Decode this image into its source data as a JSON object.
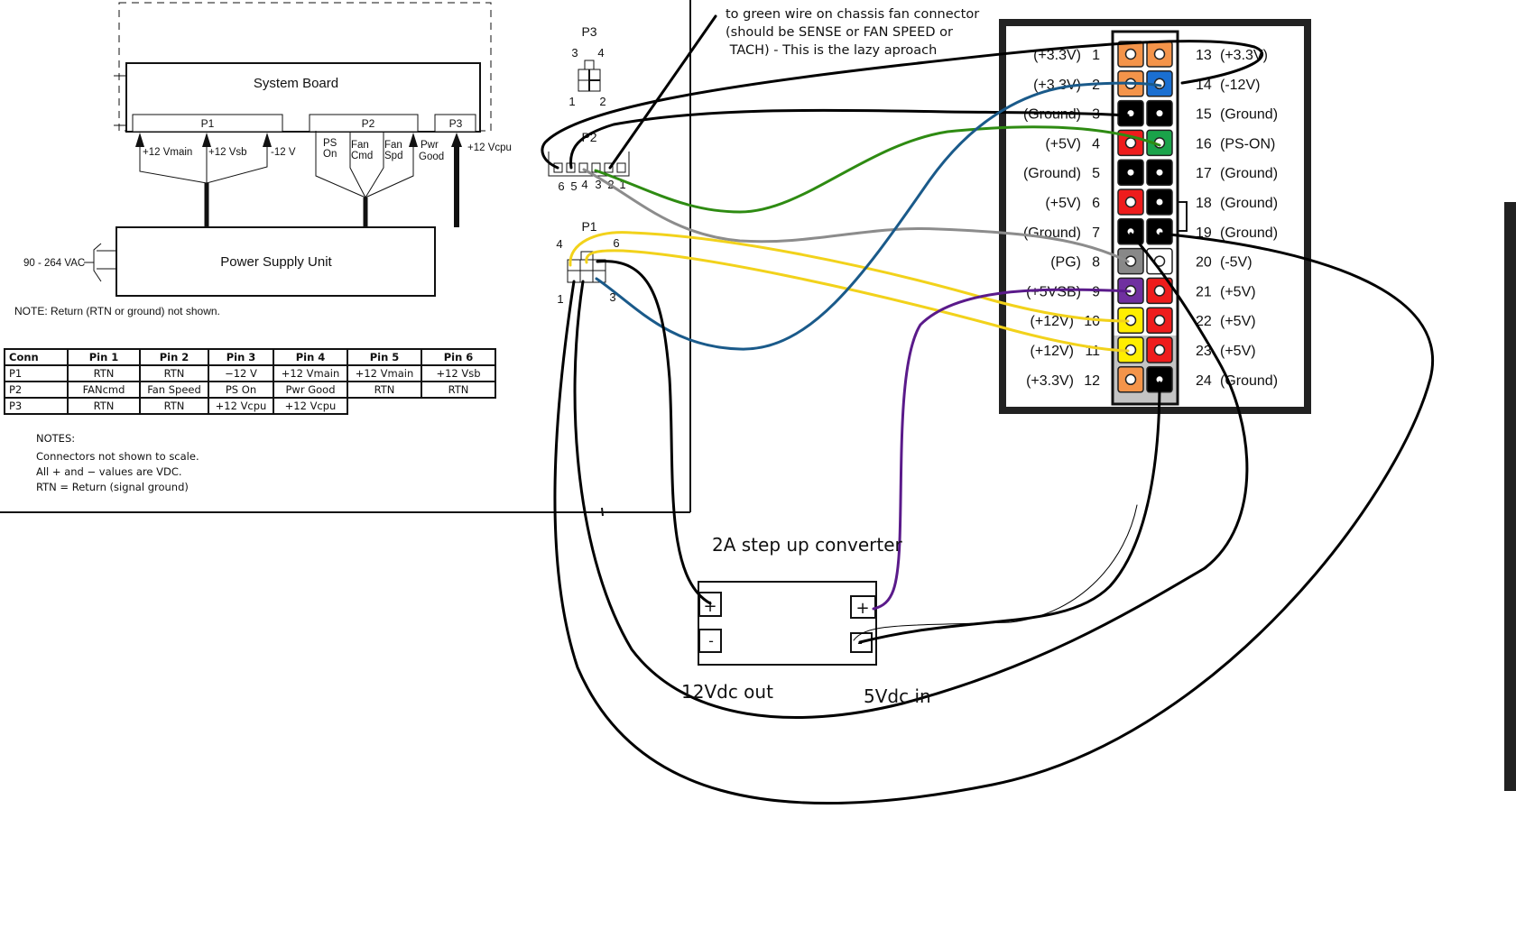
{
  "diagram": {
    "system_board": {
      "title": "System Board",
      "connectors": [
        "P1",
        "P2",
        "P3"
      ]
    },
    "psu": {
      "title": "Power Supply Unit",
      "input_label": "90 - 264 VAC"
    },
    "p1_signals": [
      "+12 Vmain",
      "+12 Vsb",
      "-12 V"
    ],
    "p2_signals": [
      {
        "line1": "PS",
        "line2": "On"
      },
      {
        "line1": "Fan",
        "line2": "Cmd"
      },
      {
        "line1": "Fan",
        "line2": "Spd"
      },
      {
        "line1": "Pwr",
        "line2": "Good"
      }
    ],
    "p3_signal": "+12 Vcpu",
    "return_note": "NOTE: Return (RTN or ground) not shown."
  },
  "pin_table": {
    "headers": [
      "Conn",
      "Pin 1",
      "Pin 2",
      "Pin 3",
      "Pin 4",
      "Pin 5",
      "Pin 6"
    ],
    "rows": [
      [
        "P1",
        "RTN",
        "RTN",
        "−12 V",
        "+12 Vmain",
        "+12 Vmain",
        "+12 Vsb"
      ],
      [
        "P2",
        "FANcmd",
        "Fan Speed",
        "PS On",
        "Pwr Good",
        "RTN",
        "RTN"
      ],
      [
        "P3",
        "RTN",
        "RTN",
        "+12 Vcpu",
        "+12 Vcpu"
      ]
    ]
  },
  "notes": {
    "heading": "NOTES:",
    "lines": [
      "Connectors not shown to scale.",
      "All + and − values are VDC.",
      "RTN = Return (signal ground)"
    ]
  },
  "connector_views": {
    "p3": {
      "label": "P3",
      "pins": [
        "3",
        "4",
        "1",
        "2"
      ]
    },
    "p2": {
      "label": "P2",
      "pins": [
        "6",
        "5",
        "4",
        "3",
        "2",
        "1"
      ]
    },
    "p1": {
      "label": "P1",
      "pins": [
        "4",
        "6",
        "1",
        "3"
      ]
    }
  },
  "annotation": {
    "lines": [
      "to green wire on chassis fan connector",
      "(should be SENSE or FAN SPEED or",
      " TACH) - This is the lazy aproach"
    ]
  },
  "converter": {
    "title": "2A step up converter",
    "out_label": "12Vdc out",
    "in_label": "5Vdc in",
    "terminals": {
      "plus": "+",
      "minus": "-"
    }
  },
  "atx24": {
    "left_pins": [
      {
        "num": "1",
        "name": "(+3.3V)",
        "color": "#f4944a"
      },
      {
        "num": "2",
        "name": "(+3.3V)",
        "color": "#f4944a"
      },
      {
        "num": "3",
        "name": "(Ground)",
        "color": "#000000"
      },
      {
        "num": "4",
        "name": "(+5V)",
        "color": "#ee1c1c"
      },
      {
        "num": "5",
        "name": "(Ground)",
        "color": "#000000"
      },
      {
        "num": "6",
        "name": "(+5V)",
        "color": "#ee1c1c"
      },
      {
        "num": "7",
        "name": "(Ground)",
        "color": "#000000"
      },
      {
        "num": "8",
        "name": "(PG)",
        "color": "#888888"
      },
      {
        "num": "9",
        "name": "(+5VSB)",
        "color": "#7030a0"
      },
      {
        "num": "10",
        "name": "(+12V)",
        "color": "#ffee00"
      },
      {
        "num": "11",
        "name": "(+12V)",
        "color": "#ffee00"
      },
      {
        "num": "12",
        "name": "(+3.3V)",
        "color": "#f4944a"
      }
    ],
    "right_pins": [
      {
        "num": "13",
        "name": "(+3.3V)",
        "color": "#f4944a"
      },
      {
        "num": "14",
        "name": "(-12V)",
        "color": "#1a6fd1"
      },
      {
        "num": "15",
        "name": "(Ground)",
        "color": "#000000"
      },
      {
        "num": "16",
        "name": "(PS-ON)",
        "color": "#1aa34a"
      },
      {
        "num": "17",
        "name": "(Ground)",
        "color": "#000000"
      },
      {
        "num": "18",
        "name": "(Ground)",
        "color": "#000000"
      },
      {
        "num": "19",
        "name": "(Ground)",
        "color": "#000000"
      },
      {
        "num": "20",
        "name": "(-5V)",
        "color": "#ffffff"
      },
      {
        "num": "21",
        "name": "(+5V)",
        "color": "#ee1c1c"
      },
      {
        "num": "22",
        "name": "(+5V)",
        "color": "#ee1c1c"
      },
      {
        "num": "23",
        "name": "(+5V)",
        "color": "#ee1c1c"
      },
      {
        "num": "24",
        "name": "(Ground)",
        "color": "#000000"
      }
    ]
  },
  "wire_colors": {
    "black": "#000000",
    "green": "#2e8b12",
    "blue": "#1a5a8a",
    "gray": "#8c8c8c",
    "yellow": "#f2d21b",
    "purple": "#5a1a8a"
  }
}
